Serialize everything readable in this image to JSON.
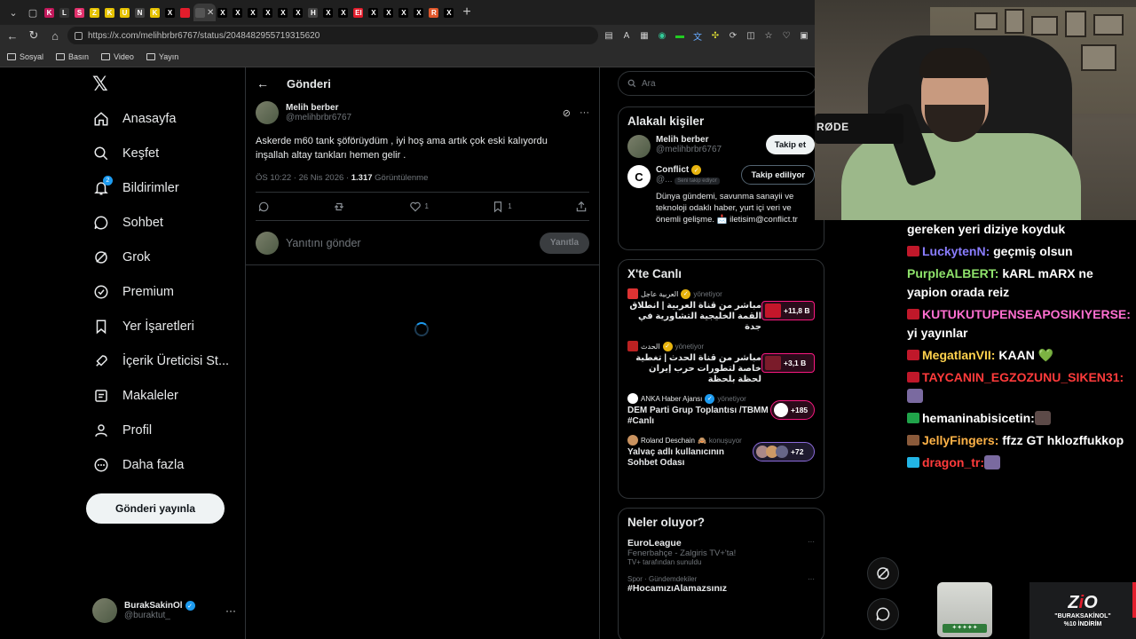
{
  "browser": {
    "tabs": [
      {
        "label": "K",
        "color": "#c2185b"
      },
      {
        "label": "L",
        "color": "#333333"
      },
      {
        "label": "S",
        "color": "#e1306c"
      },
      {
        "label": "Z",
        "color": "#e5c100"
      },
      {
        "label": "K",
        "color": "#e5c100"
      },
      {
        "label": "U",
        "color": "#e5c100"
      },
      {
        "label": "N",
        "color": "#444444"
      },
      {
        "label": "K",
        "color": "#e5c100"
      },
      {
        "label": "X",
        "color": "#000000"
      },
      {
        "label": "",
        "color": "#e21d2c"
      },
      {
        "label": "",
        "color": "#555555"
      },
      {
        "label": "X",
        "color": "#000000"
      },
      {
        "label": "X",
        "color": "#000000"
      },
      {
        "label": "X",
        "color": "#000000"
      },
      {
        "label": "X",
        "color": "#000000"
      },
      {
        "label": "X",
        "color": "#000000"
      },
      {
        "label": "X",
        "color": "#000000"
      },
      {
        "label": "H",
        "color": "#444444"
      },
      {
        "label": "X",
        "color": "#000000"
      },
      {
        "label": "X",
        "color": "#000000"
      },
      {
        "label": "El",
        "color": "#e21d2c"
      },
      {
        "label": "X",
        "color": "#000000"
      },
      {
        "label": "X",
        "color": "#000000"
      },
      {
        "label": "X",
        "color": "#000000"
      },
      {
        "label": "X",
        "color": "#000000"
      },
      {
        "label": "R",
        "color": "#e0572b"
      },
      {
        "label": "X",
        "color": "#000000"
      }
    ],
    "url": "https://x.com/melihbrbr6767/status/2048482955719315620",
    "bookmarks": [
      "Sosyal",
      "Basın",
      "Video",
      "Yayın"
    ]
  },
  "nav": {
    "items": [
      {
        "label": "Anasayfa",
        "icon": "home-icon"
      },
      {
        "label": "Keşfet",
        "icon": "search-icon"
      },
      {
        "label": "Bildirimler",
        "icon": "bell-icon",
        "badge": "2"
      },
      {
        "label": "Sohbet",
        "icon": "chat-icon"
      },
      {
        "label": "Grok",
        "icon": "grok-icon"
      },
      {
        "label": "Premium",
        "icon": "premium-icon"
      },
      {
        "label": "Yer İşaretleri",
        "icon": "bookmark-icon"
      },
      {
        "label": "İçerik Üreticisi St...",
        "icon": "rocket-icon"
      },
      {
        "label": "Makaleler",
        "icon": "article-icon"
      },
      {
        "label": "Profil",
        "icon": "profile-icon"
      },
      {
        "label": "Daha fazla",
        "icon": "more-icon"
      }
    ],
    "post_button": "Gönderi yayınla",
    "account": {
      "name": "BurakSakinOl",
      "handle": "@buraktut_"
    }
  },
  "main": {
    "header": "Gönderi",
    "post": {
      "author_name": "Melih berber",
      "author_handle": "@melihbrbr6767",
      "text_line1": "Askerde m60 tank şöförüydüm , iyi hoş ama artık çok eski kalıyordu",
      "text_line2": "inşallah altay tankları hemen gelir .",
      "time": "ÖS 10:22 · 26 Nis 2026 · ",
      "views": "1.317",
      "views_label": "Görüntülenme",
      "likes": "1",
      "bookmarks": "1"
    },
    "reply_placeholder": "Yanıtını gönder",
    "reply_button": "Yanıtla"
  },
  "right": {
    "search_placeholder": "Ara",
    "relevant": {
      "title": "Alakalı kişiler",
      "people": [
        {
          "name": "Melih berber",
          "handle": "@melihbrbr6767",
          "button": "Takip et"
        },
        {
          "name": "Conflict",
          "handle": "@...",
          "pill": "Seni takip ediyor",
          "button": "Takip ediliyor",
          "bio": "Dünya gündemi, savunma sanayii ve teknoloji odaklı haber, yurt içi veri ve önemli gelişme. 📩 iletisim@conflict.tr"
        }
      ]
    },
    "live": {
      "title": "X'te Canlı",
      "items": [
        {
          "host": "العربية عاجل",
          "status": "yönetiyor",
          "title": "مباشر من قناة العربية | انطلاق القمة الخليجية التشاورية في جدة",
          "count": "+11,8 B",
          "rtl": true
        },
        {
          "host": "الحدث",
          "status": "yönetiyor",
          "title": "مباشر من قناة الحدث | تغطية خاصة لتطورات حرب إيران لحظة بلحظة",
          "count": "+3,1 B",
          "rtl": true
        },
        {
          "host": "ANKA Haber Ajansı",
          "status": "yönetiyor",
          "title": "DEM Parti Grup Toplantısı /TBMM #Canlı",
          "count": "+185",
          "rtl": false
        },
        {
          "host": "Roland Deschain",
          "status": "konuşuyor",
          "title": "Yalvaç adlı kullanıcının Sohbet Odası",
          "count": "+72",
          "rtl": false
        }
      ]
    },
    "trends": {
      "title": "Neler oluyor?",
      "items": [
        {
          "title": "EuroLeague",
          "sub": "Fenerbahçe - Zalgiris TV+'ta!",
          "cat": "TV+ tarafından sunuldu"
        },
        {
          "cat": "Spor · Gündemdekiler",
          "title": "#HocamızıAlamazsınız"
        }
      ]
    }
  },
  "stream": {
    "mic_brand": "RØDE",
    "chat": [
      {
        "user": "",
        "text": "gereken yeri diziye koyduk",
        "color": "#ffffff",
        "badge": ""
      },
      {
        "user": "LuckytenN:",
        "text": " geçmiş olsun",
        "color": "#8a7dff",
        "badge": "red"
      },
      {
        "user": "PurpleALBERT:",
        "text": " kARL mARX ne yapion orada reiz",
        "color": "#8fe36b",
        "badge": ""
      },
      {
        "user": "KUTUKUTUPENSEAPOSIKIYERSE:",
        "text": " yi yayınlar",
        "color": "#ff6fd1",
        "badge": "red"
      },
      {
        "user": "MegatlanVII:",
        "text": " KAAN 💚",
        "color": "#ffd24d",
        "badge": "red"
      },
      {
        "user": "TAYCANIN_EGZOZUNU_SIKEN31:",
        "text": "",
        "color": "#ff3b3b",
        "badge": "red"
      },
      {
        "user": "hemaninabisicetin:",
        "text": "",
        "color": "#ffffff",
        "badge": "green"
      },
      {
        "user": "JellyFingers:",
        "text": " ffzz GT hklozffukkop",
        "color": "#ffb347",
        "badge": "brown"
      },
      {
        "user": "dragon_tr:",
        "text": "",
        "color": "#ff3b3b",
        "badge": "cyan"
      }
    ],
    "sponsor_line1": "\"BURAKSAKİNOL\"",
    "sponsor_line2": "%10 İNDİRİM"
  }
}
